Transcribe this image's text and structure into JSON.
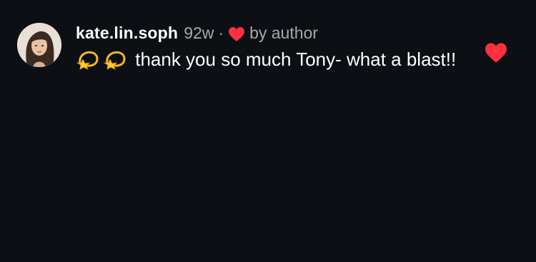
{
  "comment": {
    "username": "kate.lin.soph",
    "time": "92w",
    "separator": "·",
    "liked_by_author_label": "by author",
    "text": "thank you so much Tony- what a blast!!",
    "emojis": [
      "dizzy-emoji",
      "dizzy-emoji"
    ],
    "like_icon": "heart-icon",
    "accent_color": "#ff3040",
    "liked": true
  }
}
